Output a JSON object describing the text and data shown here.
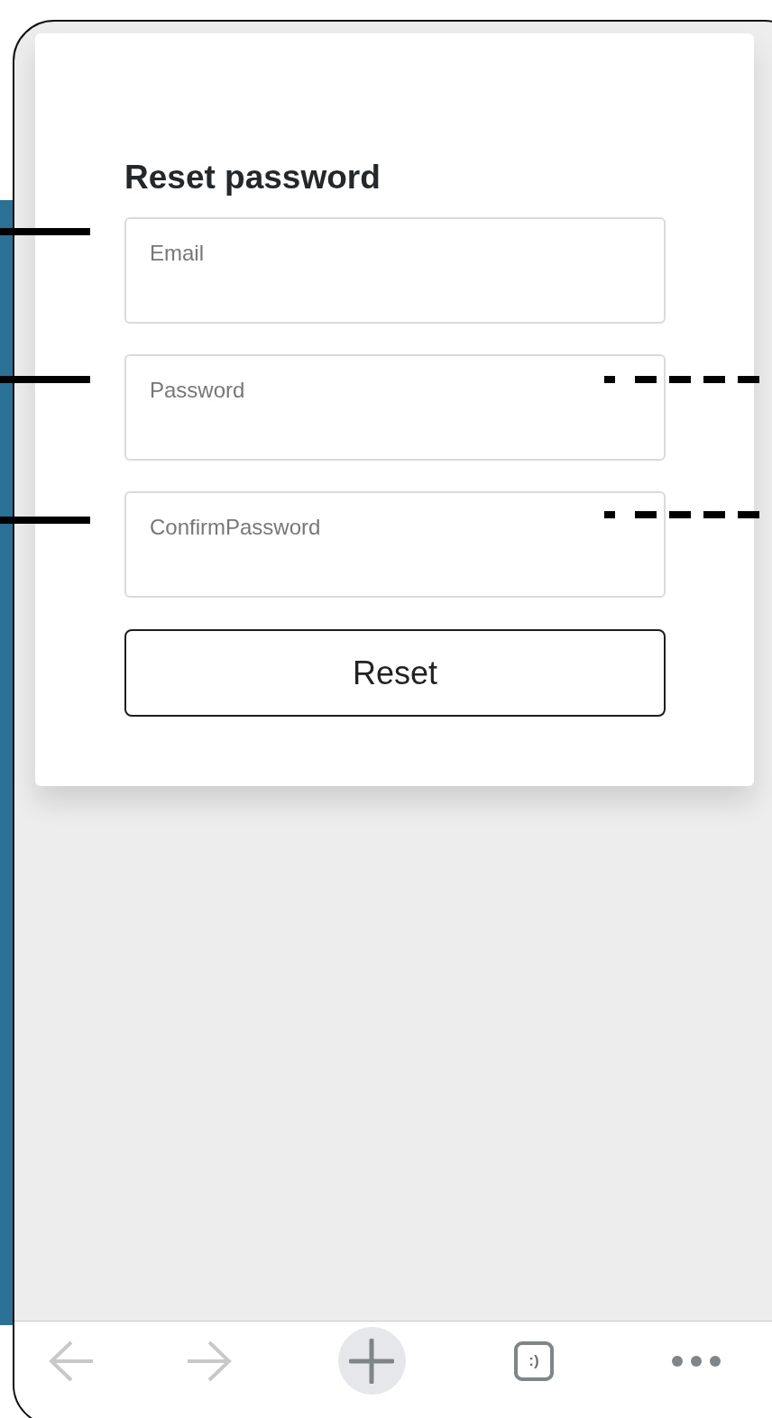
{
  "form": {
    "title": "Reset password",
    "fields": [
      {
        "placeholder": "Email"
      },
      {
        "placeholder": "Password"
      },
      {
        "placeholder": "ConfirmPassword"
      }
    ],
    "button": "Reset"
  },
  "toolbar": [
    {
      "kind": "back",
      "disabled": true
    },
    {
      "kind": "forward",
      "disabled": true
    },
    {
      "kind": "new-tab",
      "disabled": false
    },
    {
      "kind": "tabs",
      "label": ":)",
      "disabled": false
    },
    {
      "kind": "menu",
      "disabled": false
    }
  ]
}
